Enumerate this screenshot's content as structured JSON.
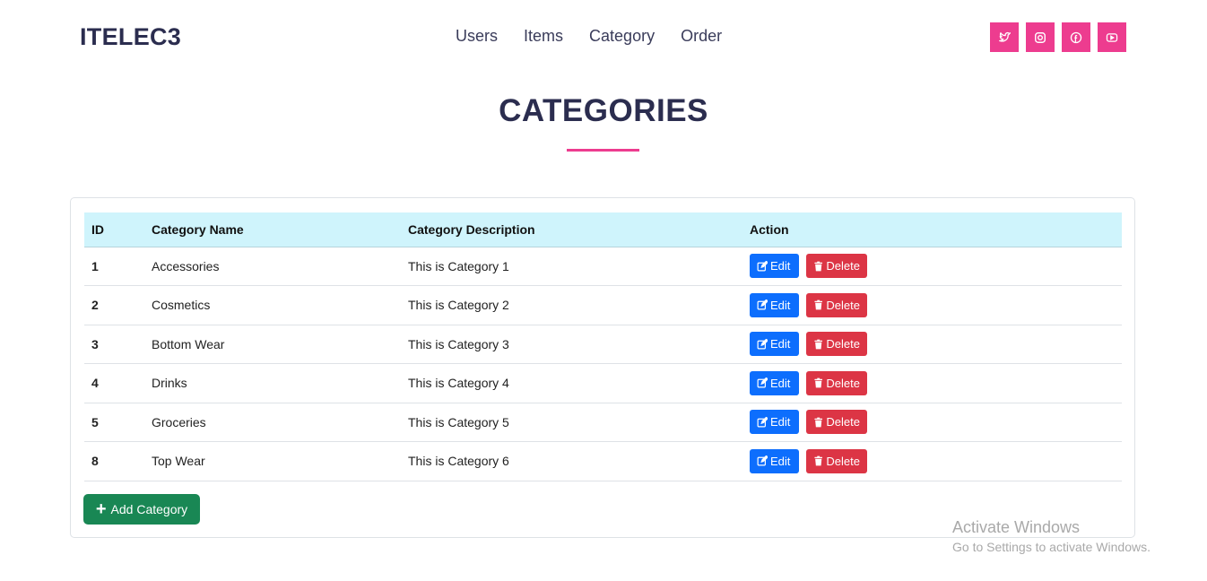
{
  "brand": "ITELEC3",
  "nav": [
    "Users",
    "Items",
    "Category",
    "Order"
  ],
  "social": [
    "twitter-icon",
    "instagram-icon",
    "facebook-icon",
    "youtube-icon"
  ],
  "page_title": "CATEGORIES",
  "table": {
    "headers": [
      "ID",
      "Category Name",
      "Category Description",
      "Action"
    ],
    "rows": [
      {
        "id": "1",
        "name": "Accessories",
        "description": "This is Category 1"
      },
      {
        "id": "2",
        "name": "Cosmetics",
        "description": "This is Category 2"
      },
      {
        "id": "3",
        "name": "Bottom Wear",
        "description": "This is Category 3"
      },
      {
        "id": "4",
        "name": "Drinks",
        "description": "This is Category 4"
      },
      {
        "id": "5",
        "name": "Groceries",
        "description": "This is Category 5"
      },
      {
        "id": "8",
        "name": "Top Wear",
        "description": "This is Category 6"
      }
    ],
    "edit_label": "Edit",
    "delete_label": "Delete"
  },
  "add_button": "Add Category",
  "watermark": {
    "line1": "Activate Windows",
    "line2": "Go to Settings to activate Windows."
  },
  "colors": {
    "accent": "#ed3c8f",
    "edit": "#0d6efd",
    "delete": "#dc3545",
    "add": "#198754",
    "header_bg": "#cff4fc"
  }
}
